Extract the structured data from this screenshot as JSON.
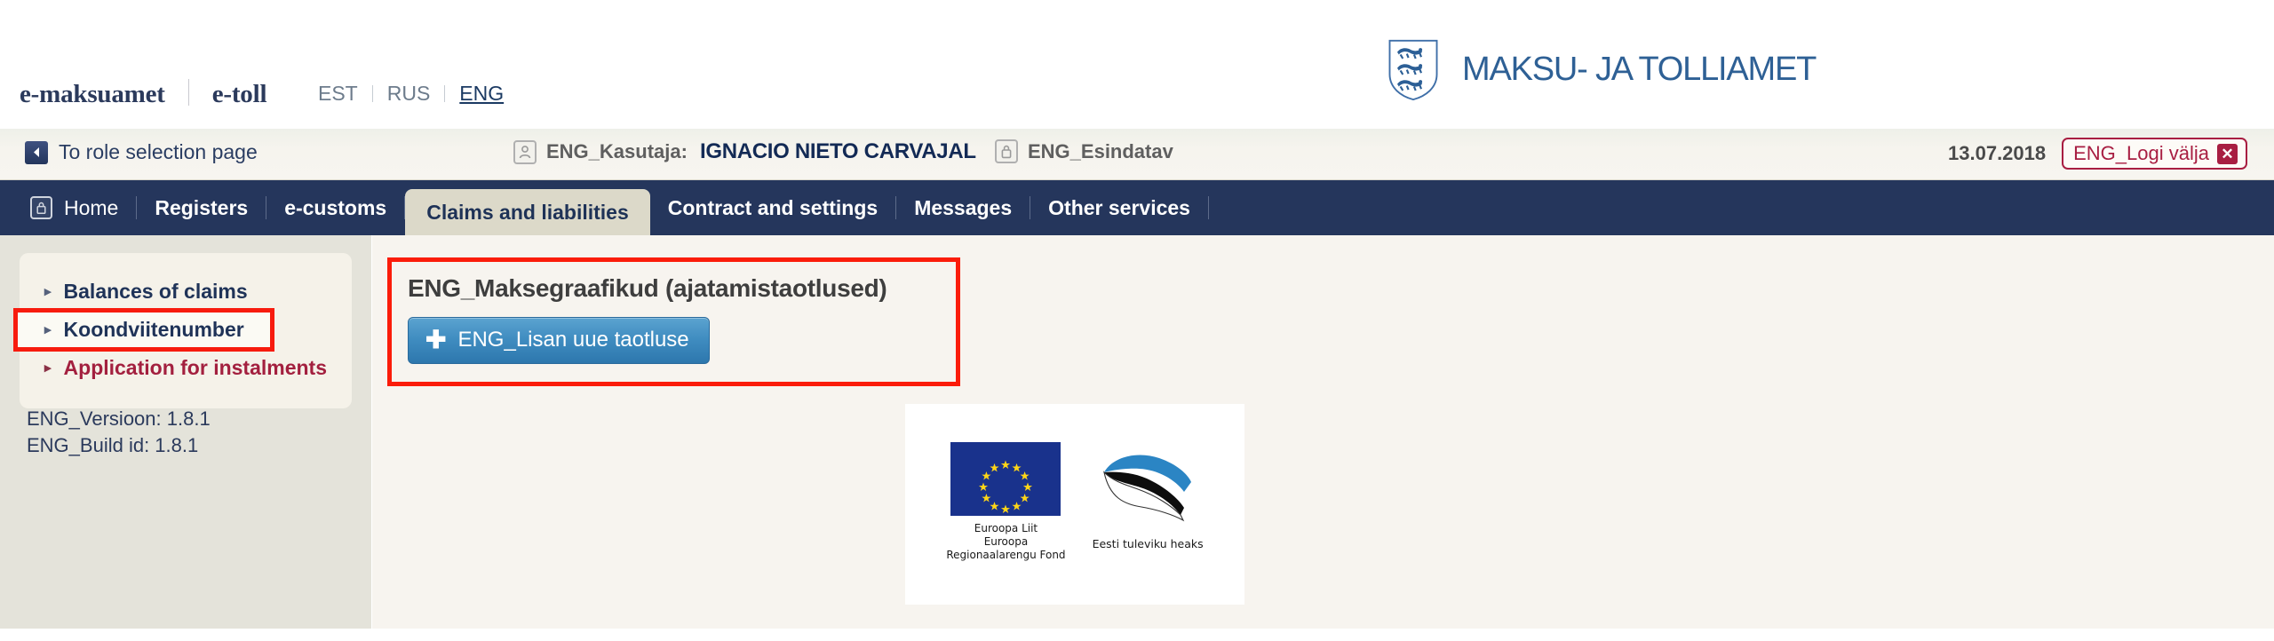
{
  "header": {
    "brand_primary": "e-maksuamet",
    "brand_secondary": "e-toll",
    "languages": [
      {
        "code": "EST",
        "active": false
      },
      {
        "code": "RUS",
        "active": false
      },
      {
        "code": "ENG",
        "active": true
      }
    ],
    "agency_logo_text": "MAKSU- JA TOLLIAMET"
  },
  "user_bar": {
    "role_link_label": "To role selection page",
    "user_label": "ENG_Kasutaja:",
    "user_name": "IGNACIO NIETO CARVAJAL",
    "represented_label": "ENG_Esindatav",
    "date": "13.07.2018",
    "logout_label": "ENG_Logi välja",
    "logout_icon": "close-x-icon",
    "user_icon": "user-avatar-icon",
    "represented_icon": "briefcase-icon",
    "back_icon": "back-arrow-icon"
  },
  "nav": {
    "home_icon": "home-icon",
    "items": [
      {
        "label": "Home",
        "active": false,
        "has_icon": true
      },
      {
        "label": "Registers",
        "active": false
      },
      {
        "label": "e-customs",
        "active": false
      },
      {
        "label": "Claims and liabilities",
        "active": true
      },
      {
        "label": "Contract and settings",
        "active": false
      },
      {
        "label": "Messages",
        "active": false
      },
      {
        "label": "Other services",
        "active": false
      }
    ]
  },
  "sidebar": {
    "items": [
      {
        "label": "Balances of claims",
        "style": "navy",
        "highlighted": false
      },
      {
        "label": "Koondviitenumber",
        "style": "navy",
        "highlighted": true
      },
      {
        "label": "Application for instalments",
        "style": "maroon",
        "highlighted": false
      }
    ],
    "version_line": "ENG_Versioon: 1.8.1",
    "build_line": "ENG_Build id: 1.8.1"
  },
  "main": {
    "title": "ENG_Maksegraafikud (ajatamistaotlused)",
    "add_button_label": "ENG_Lisan uue taotluse",
    "add_button_icon": "plus-icon"
  },
  "footer_logos": {
    "eu_caption_line1": "Euroopa Liit",
    "eu_caption_line2": "Euroopa",
    "eu_caption_line3": "Regionaalarengu Fond",
    "ee_caption": "Eesti tuleviku heaks",
    "eu_flag_icon": "european-union-flag-icon",
    "ee_flag_icon": "estonia-flag-swoosh-icon"
  },
  "colors": {
    "navbar": "#25365C",
    "page_bg": "#F7F4EF",
    "sidebar_bg": "#E4E3DA",
    "active_tab": "#DCD9C9",
    "accent_blue": "#3F8CC0",
    "accent_red": "#A3203F",
    "highlight_red": "#FB1C0A",
    "logo_blue": "#2E6095"
  }
}
